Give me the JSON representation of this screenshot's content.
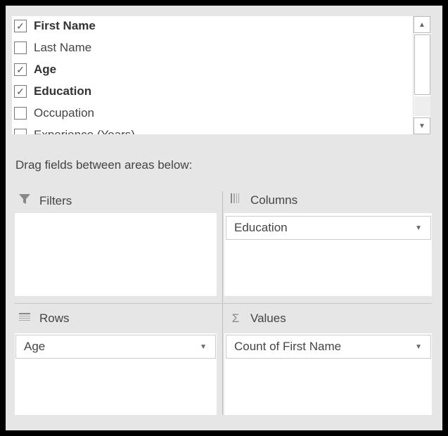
{
  "fields": [
    {
      "label": "First Name",
      "checked": true
    },
    {
      "label": "Last Name",
      "checked": false
    },
    {
      "label": "Age",
      "checked": true
    },
    {
      "label": "Education",
      "checked": true
    },
    {
      "label": "Occupation",
      "checked": false
    },
    {
      "label": "Experience (Years)",
      "checked": false
    }
  ],
  "check_glyph": "✓",
  "scroll": {
    "up": "▲",
    "down": "▼"
  },
  "drag_label": "Drag fields between areas below:",
  "areas": {
    "filters": {
      "title": "Filters",
      "icon": "filter-icon",
      "items": []
    },
    "columns": {
      "title": "Columns",
      "icon": "columns-icon",
      "items": [
        "Education"
      ]
    },
    "rows": {
      "title": "Rows",
      "icon": "rows-icon",
      "items": [
        "Age"
      ]
    },
    "values": {
      "title": "Values",
      "icon": "sigma-icon",
      "items": [
        "Count of First Name"
      ]
    }
  },
  "dropdown_glyph": "▼"
}
